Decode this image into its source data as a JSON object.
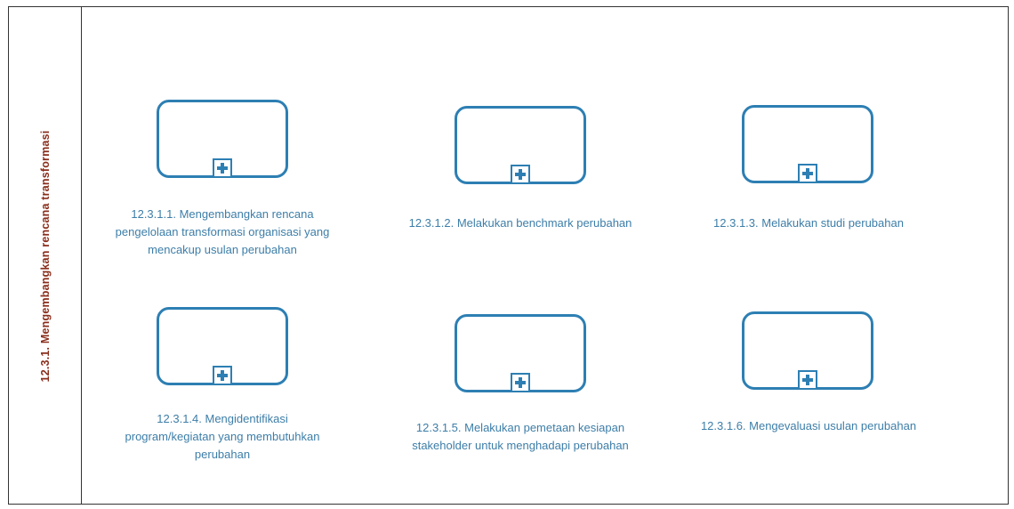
{
  "lane": {
    "label": "12.3.1. Mengembangkan rencana transformasi"
  },
  "tasks": [
    {
      "label": "12.3.1.1. Mengembangkan rencana pengelolaan transformasi organisasi yang mencakup usulan perubahan"
    },
    {
      "label": "12.3.1.2. Melakukan benchmark perubahan"
    },
    {
      "label": "12.3.1.3. Melakukan studi perubahan"
    },
    {
      "label": "12.3.1.4. Mengidentifikasi program/kegiatan yang membutuhkan perubahan"
    },
    {
      "label": "12.3.1.5. Melakukan pemetaan kesiapan stakeholder untuk menghadapi perubahan"
    },
    {
      "label": "12.3.1.6. Mengevaluasi usulan perubahan"
    }
  ],
  "colors": {
    "task_border": "#2d7fb3",
    "caption": "#3d7ea8",
    "lane_label": "#8a2e1c"
  },
  "icons": {
    "subprocess_marker": "plus-square-icon"
  }
}
